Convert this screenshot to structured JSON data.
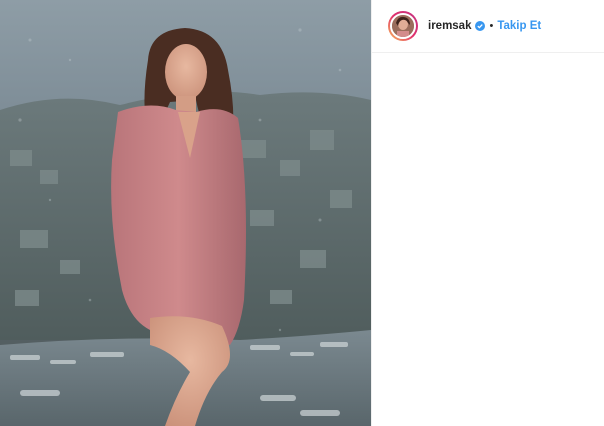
{
  "post": {
    "username": "iremsak",
    "separator": "•",
    "follow_label": "Takip Et",
    "verified_icon": "verified-badge-icon",
    "colors": {
      "follow": "#3897f0",
      "verified": "#3897f0",
      "text": "#262626"
    }
  }
}
